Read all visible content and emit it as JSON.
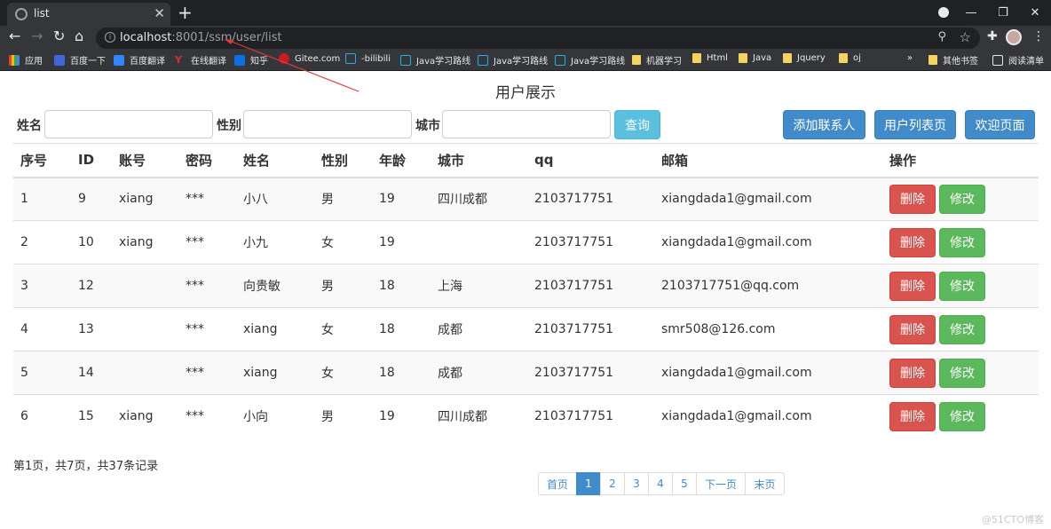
{
  "browser": {
    "tab_title": "list",
    "url_host": "localhost",
    "url_rest": ":8001/ssm/user/list",
    "bookmarks": [
      "应用",
      "百度一下",
      "百度翻译",
      "在线翻译",
      "知乎",
      "Gitee.com",
      "-bilibili",
      "Java学习路线",
      "Java学习路线",
      "Java学习路线",
      "机器学习",
      "Html",
      "Java",
      "Jquery",
      "oj"
    ],
    "bookmarks_more": "»",
    "other_bookmarks": "其他书签",
    "reading_list": "阅读清单"
  },
  "page": {
    "title": "用户展示",
    "search": {
      "name_label": "姓名",
      "gender_label": "性别",
      "city_label": "城市",
      "name_value": "",
      "gender_value": "",
      "city_value": "",
      "query_button": "查询"
    },
    "actions": {
      "add_contact": "添加联系人",
      "user_list": "用户列表页",
      "welcome": "欢迎页面"
    },
    "table": {
      "columns": [
        "序号",
        "ID",
        "账号",
        "密码",
        "姓名",
        "性别",
        "年龄",
        "城市",
        "qq",
        "邮箱",
        "操作"
      ],
      "rows": [
        [
          "1",
          "9",
          "xiang",
          "***",
          "小八",
          "男",
          "19",
          "四川成都",
          "2103717751",
          "xiangdada1@gmail.com"
        ],
        [
          "2",
          "10",
          "xiang",
          "***",
          "小九",
          "女",
          "19",
          "",
          "2103717751",
          "xiangdada1@gmail.com"
        ],
        [
          "3",
          "12",
          "",
          "***",
          "向贵敏",
          "男",
          "18",
          "上海",
          "2103717751",
          "2103717751@qq.com"
        ],
        [
          "4",
          "13",
          "",
          "***",
          "xiang",
          "女",
          "18",
          "成都",
          "2103717751",
          "smr508@126.com"
        ],
        [
          "5",
          "14",
          "",
          "***",
          "xiang",
          "女",
          "18",
          "成都",
          "2103717751",
          "xiangdada1@gmail.com"
        ],
        [
          "6",
          "15",
          "xiang",
          "***",
          "小向",
          "男",
          "19",
          "四川成都",
          "2103717751",
          "xiangdada1@gmail.com"
        ]
      ],
      "delete_label": "删除",
      "edit_label": "修改"
    },
    "page_info": "第1页，共7页，共37条记录",
    "pagination": {
      "first": "首页",
      "pages": [
        "1",
        "2",
        "3",
        "4",
        "5"
      ],
      "active_page": "1",
      "next": "下一页",
      "last": "末页"
    },
    "watermark": "@51CTO博客"
  },
  "colors": {
    "chrome_dark": "#202124",
    "chrome_bar": "#35363a",
    "primary": "#428bca",
    "info": "#5bc0de",
    "danger": "#d9534f",
    "success": "#5cb85c",
    "annotation_arrow": "#e23b3b"
  }
}
